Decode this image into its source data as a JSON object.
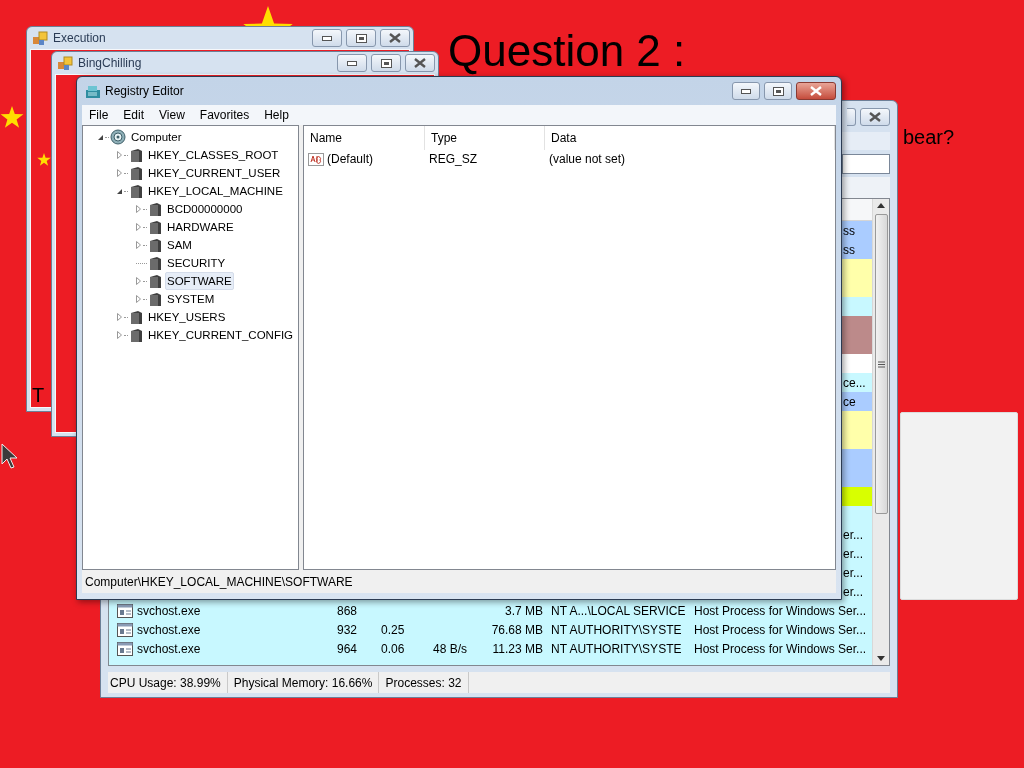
{
  "quiz": {
    "question_title": "Question 2 :",
    "question_tail": "bear?",
    "answer_text": "T"
  },
  "execution_window": {
    "title": "Execution"
  },
  "bingchilling_window": {
    "title": "BingChilling"
  },
  "task_manager": {
    "rows": [
      {
        "kind": "partial",
        "color": "#aaccff",
        "description": "ss"
      },
      {
        "kind": "partial",
        "color": "#aaccff",
        "description": "ss"
      },
      {
        "kind": "partial",
        "color": "#ffffaa"
      },
      {
        "kind": "partial",
        "color": "#ffffaa"
      },
      {
        "kind": "partial",
        "color": "#c8f8ff"
      },
      {
        "kind": "partial",
        "color": "#bc8a8a"
      },
      {
        "kind": "partial",
        "color": "#bc8a8a"
      },
      {
        "kind": "partial",
        "color": "#ffffff"
      },
      {
        "kind": "partial",
        "color": "#c8f8ff",
        "description": "ce..."
      },
      {
        "kind": "partial",
        "color": "#aaccff",
        "description": "ce"
      },
      {
        "kind": "partial",
        "color": "#ffffaa"
      },
      {
        "kind": "partial",
        "color": "#ffffaa"
      },
      {
        "kind": "partial",
        "color": "#aaccff"
      },
      {
        "kind": "partial",
        "color": "#aaccff"
      },
      {
        "kind": "partial",
        "color": "#d8ff00"
      },
      {
        "kind": "partial",
        "color": "#c8f8ff"
      },
      {
        "kind": "partial",
        "color": "#c8f8ff",
        "description": "er..."
      },
      {
        "kind": "partial",
        "color": "#c8f8ff",
        "description": "er..."
      },
      {
        "kind": "partial",
        "color": "#c8f8ff",
        "description": "er..."
      },
      {
        "kind": "partial",
        "color": "#c8f8ff",
        "description": "er..."
      },
      {
        "kind": "full",
        "color": "#c8f8ff",
        "name": "svchost.exe",
        "pid": "868",
        "memory": "3.7 MB",
        "user": "NT A...\\LOCAL SERVICE",
        "description": "Host Process for Windows Ser..."
      },
      {
        "kind": "full",
        "color": "#c8f8ff",
        "name": "svchost.exe",
        "pid": "932",
        "cpu": "0.25",
        "memory": "76.68 MB",
        "user": "NT AUTHORITY\\SYSTE",
        "description": "Host Process for Windows Ser..."
      },
      {
        "kind": "full",
        "color": "#c8f8ff",
        "name": "svchost.exe",
        "pid": "964",
        "cpu": "0.06",
        "io": "48 B/s",
        "memory": "11.23 MB",
        "user": "NT AUTHORITY\\SYSTE",
        "description": "Host Process for Windows Ser..."
      }
    ],
    "status_bar": [
      "CPU Usage: 38.99%",
      "Physical Memory: 16.66%",
      "Processes: 32"
    ]
  },
  "registry_editor": {
    "title": "Registry Editor",
    "menu": [
      "File",
      "Edit",
      "View",
      "Favorites",
      "Help"
    ],
    "tree": {
      "label": "Computer",
      "kind": "computer",
      "expandable": true,
      "expanded": true,
      "selected": false,
      "children": [
        {
          "label": "HKEY_CLASSES_ROOT",
          "kind": "key",
          "expandable": true,
          "expanded": false,
          "selected": false
        },
        {
          "label": "HKEY_CURRENT_USER",
          "kind": "key",
          "expandable": true,
          "expanded": false,
          "selected": false
        },
        {
          "label": "HKEY_LOCAL_MACHINE",
          "kind": "key",
          "expandable": true,
          "expanded": true,
          "selected": false,
          "children": [
            {
              "label": "BCD00000000",
              "kind": "key",
              "expandable": true,
              "expanded": false,
              "selected": false
            },
            {
              "label": "HARDWARE",
              "kind": "key",
              "expandable": true,
              "expanded": false,
              "selected": false
            },
            {
              "label": "SAM",
              "kind": "key",
              "expandable": true,
              "expanded": false,
              "selected": false
            },
            {
              "label": "SECURITY",
              "kind": "key",
              "expandable": false,
              "selected": false
            },
            {
              "label": "SOFTWARE",
              "kind": "key",
              "expandable": true,
              "expanded": false,
              "selected": true
            },
            {
              "label": "SYSTEM",
              "kind": "key",
              "expandable": true,
              "expanded": false,
              "selected": false
            }
          ]
        },
        {
          "label": "HKEY_USERS",
          "kind": "key",
          "expandable": true,
          "expanded": false,
          "selected": false
        },
        {
          "label": "HKEY_CURRENT_CONFIG",
          "kind": "key",
          "expandable": true,
          "expanded": false,
          "selected": false
        }
      ]
    },
    "columns": [
      "Name",
      "Type",
      "Data"
    ],
    "values": [
      {
        "name": "(Default)",
        "type": "REG_SZ",
        "data": "(value not set)"
      }
    ],
    "status_bar": "Computer\\HKEY_LOCAL_MACHINE\\SOFTWARE"
  }
}
